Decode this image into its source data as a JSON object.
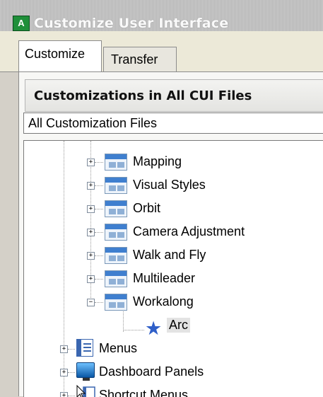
{
  "window": {
    "title": "Customize User Interface",
    "app_icon": "cui-app-icon"
  },
  "tabs": [
    {
      "label": "Customize",
      "active": true
    },
    {
      "label": "Transfer",
      "active": false
    }
  ],
  "panel": {
    "header": "Customizations in All CUI Files",
    "dropdown_value": "All Customization Files"
  },
  "tree": {
    "toolbars": [
      {
        "label": "Mapping",
        "expander": "+"
      },
      {
        "label": "Visual Styles",
        "expander": "+"
      },
      {
        "label": "Orbit",
        "expander": "+"
      },
      {
        "label": "Camera Adjustment",
        "expander": "+"
      },
      {
        "label": "Walk and Fly",
        "expander": "+"
      },
      {
        "label": "Multileader",
        "expander": "+"
      },
      {
        "label": "Workalong",
        "expander": "−"
      }
    ],
    "workalong_child": {
      "label": "Arc",
      "icon": "star-icon"
    },
    "top_level": [
      {
        "label": "Menus",
        "expander": "+",
        "icon": "menu-icon"
      },
      {
        "label": "Dashboard Panels",
        "expander": "+",
        "icon": "dashboard-panel-icon"
      },
      {
        "label": "Shortcut Menus",
        "expander": "+",
        "icon": "shortcut-menu-icon"
      }
    ]
  },
  "colors": {
    "selection_bg": "#e3e3e3",
    "tree_bg": "#ffffff",
    "star": "#2f5fc8"
  }
}
